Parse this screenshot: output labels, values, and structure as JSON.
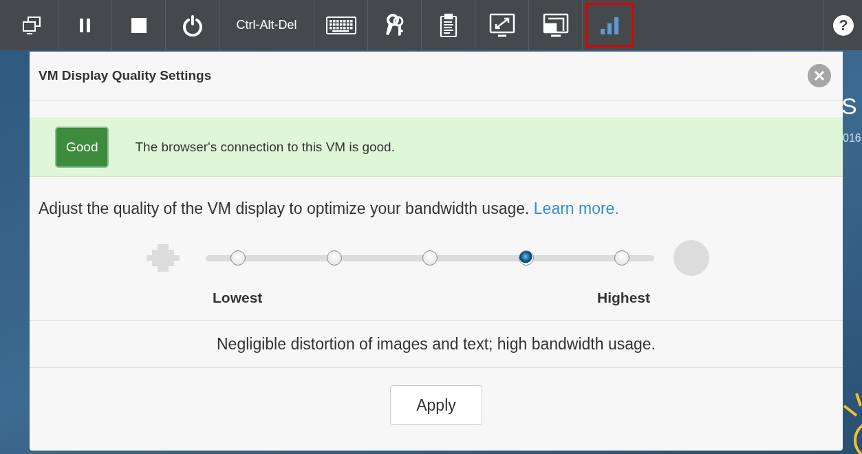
{
  "toolbar": {
    "items": [
      {
        "kind": "icon",
        "selected": false
      },
      {
        "kind": "icon",
        "selected": false
      },
      {
        "kind": "icon",
        "selected": false
      },
      {
        "kind": "icon",
        "selected": false
      },
      {
        "kind": "text",
        "label": "Ctrl-Alt-Del",
        "selected": false
      },
      {
        "kind": "icon",
        "selected": false
      },
      {
        "kind": "icon",
        "selected": false
      },
      {
        "kind": "icon",
        "selected": false
      },
      {
        "kind": "icon",
        "selected": false
      },
      {
        "kind": "icon",
        "selected": false
      },
      {
        "kind": "icon",
        "selected": true
      }
    ],
    "help": "?"
  },
  "desktop": {
    "texts": [
      "S",
      "016"
    ]
  },
  "dialog": {
    "title": "VM Display Quality Settings",
    "status": {
      "badge": "Good",
      "message": "The browser's connection to this VM is good."
    },
    "intro": "Adjust the quality of the VM display to optimize your bandwidth usage.",
    "link": "Learn more.",
    "levels": [
      {
        "selected": false
      },
      {
        "selected": false
      },
      {
        "selected": false
      },
      {
        "selected": true
      },
      {
        "selected": false
      }
    ],
    "low_label": "Lowest",
    "high_label": "Highest",
    "description": "Negligible distortion of images and text; high bandwidth usage.",
    "apply": "Apply"
  }
}
